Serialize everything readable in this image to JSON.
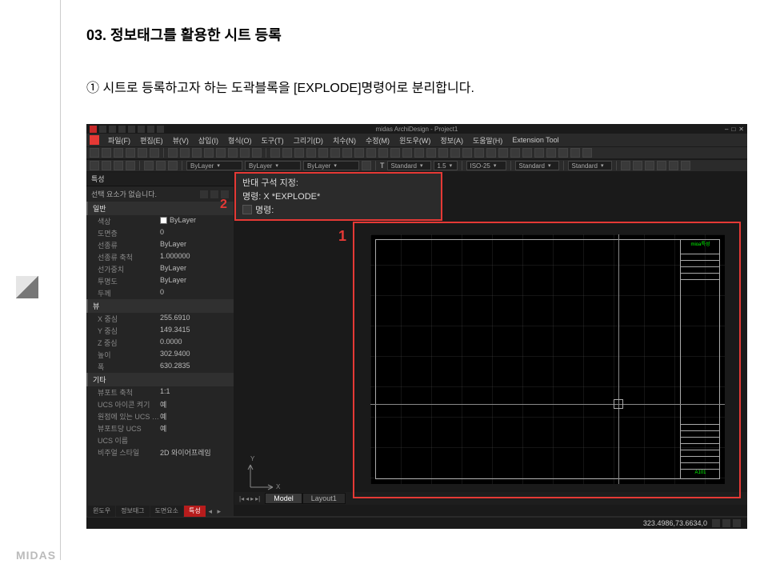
{
  "page": {
    "section_number": "03.",
    "section_title": "정보태그를 활용한 시트 등록",
    "instruction_num": "①",
    "instruction_text": "시트로 등록하고자 하는 도곽블록을 [EXPLODE]명령어로 분리합니다."
  },
  "logo": "MIDAS",
  "app": {
    "title": "midas ArchiDesign - Project1",
    "win_min": "–",
    "win_max": "□",
    "win_close": "✕",
    "menu": [
      "파일(F)",
      "편집(E)",
      "뷰(V)",
      "삽입(I)",
      "형식(O)",
      "도구(T)",
      "그리기(D)",
      "치수(N)",
      "수정(M)",
      "윈도우(W)",
      "정보(A)",
      "도움말(H)",
      "Extension Tool"
    ],
    "toolbar2": {
      "layer_color": "ByLayer",
      "layer_lt": "ByLayer",
      "layer_lw": "ByLayer",
      "textstyle": "Standard",
      "scale": "1.5",
      "dimstyle": "ISO-25",
      "tablestyle": "Standard",
      "mleader": "Standard"
    },
    "props_title": "특성",
    "no_selection": "선택 요소가 없습니다.",
    "groups": {
      "general": "일반",
      "view": "뷰",
      "misc": "기타"
    },
    "general": [
      {
        "k": "색상",
        "v": "ByLayer",
        "swatch": true
      },
      {
        "k": "도면층",
        "v": "0"
      },
      {
        "k": "선종류",
        "v": "ByLayer"
      },
      {
        "k": "선종류 축척",
        "v": "1.000000"
      },
      {
        "k": "선가중치",
        "v": "ByLayer"
      },
      {
        "k": "투명도",
        "v": "ByLayer"
      },
      {
        "k": "두께",
        "v": "0"
      }
    ],
    "view": [
      {
        "k": "X 중심",
        "v": "255.6910"
      },
      {
        "k": "Y 중심",
        "v": "149.3415"
      },
      {
        "k": "Z 중심",
        "v": "0.0000"
      },
      {
        "k": "높이",
        "v": "302.9400"
      },
      {
        "k": "폭",
        "v": "630.2835"
      }
    ],
    "misc": [
      {
        "k": "뷰포트 축척",
        "v": "1:1"
      },
      {
        "k": "UCS 아이콘 켜기",
        "v": "예"
      },
      {
        "k": "원점에 있는 UCS …",
        "v": "예"
      },
      {
        "k": "뷰포트당 UCS",
        "v": "예"
      },
      {
        "k": "UCS 이름",
        "v": ""
      },
      {
        "k": "비주얼 스타일",
        "v": "2D 와이어프레임"
      }
    ],
    "cmd": {
      "line1": "반대 구석 지정:",
      "line2": "명령: X *EXPLODE*",
      "prompt": "명령:"
    },
    "layout_tabs": {
      "model": "Model",
      "layout1": "Layout1"
    },
    "status": {
      "coords": "323.4986,73.6634,0"
    },
    "bottom_tabs": [
      "윈도우",
      "정보태그",
      "도면요소",
      "특성"
    ],
    "titleblock_top": "mioa특성",
    "titleblock_bottom": "A101",
    "ucs": {
      "x": "X",
      "y": "Y"
    }
  },
  "annotations": {
    "one": "1",
    "two": "2"
  }
}
